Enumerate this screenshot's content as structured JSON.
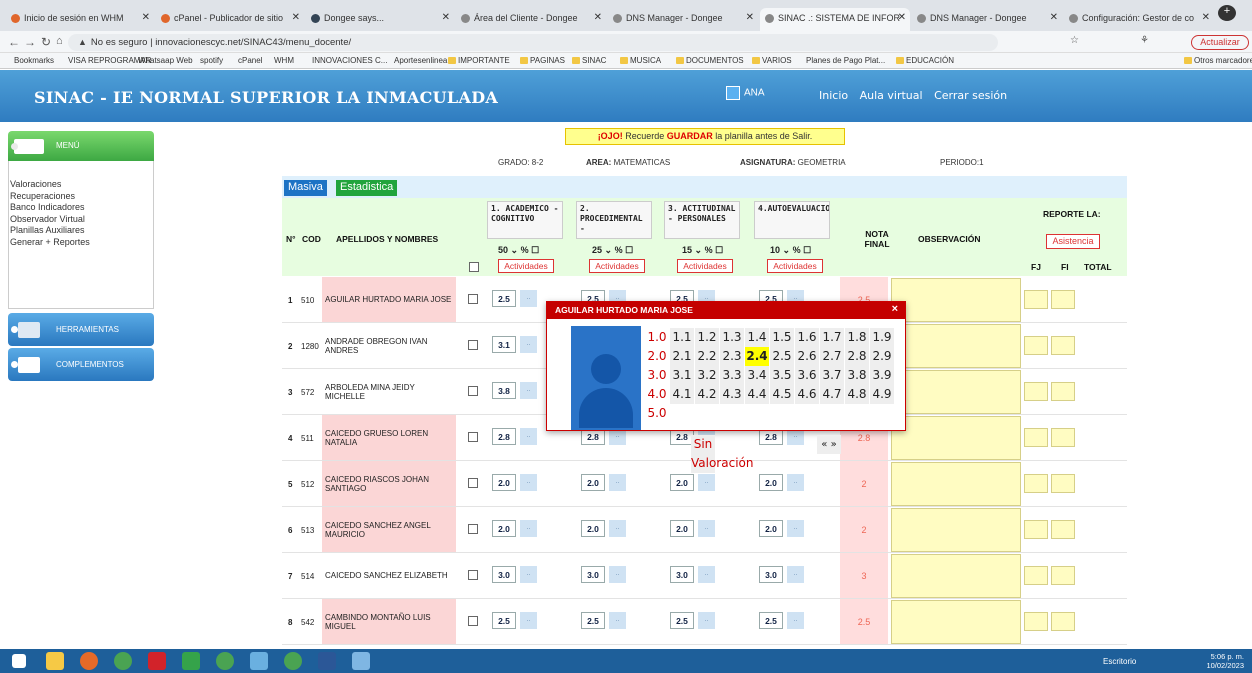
{
  "browser": {
    "tabs": [
      {
        "title": "Inicio de sesión en WHM"
      },
      {
        "title": "cPanel - Publicador de sitio"
      },
      {
        "title": "Dongee says..."
      },
      {
        "title": "Área del Cliente - Dongee"
      },
      {
        "title": "DNS Manager - Dongee"
      },
      {
        "title": "SINAC .: SISTEMA DE INFOR"
      },
      {
        "title": "DNS Manager - Dongee"
      },
      {
        "title": "Configuración: Gestor de co"
      }
    ],
    "security_label": "No es seguro",
    "url": "innovacionescyc.net/SINAC43/menu_docente/",
    "update_button": "Actualizar",
    "bookmarks": [
      "Bookmarks",
      "VISA REPROGRAMAR",
      "Whatsaap Web",
      "spotify",
      "cPanel",
      "WHM",
      "INNOVACIONES C...",
      "Aportesenlinea",
      "IMPORTANTE",
      "PAGINAS",
      "SINAC",
      "MUSICA",
      "DOCUMENTOS",
      "VARIOS",
      "Planes de Pago Plat...",
      "EDUCACIÓN",
      "Otros marcadores"
    ]
  },
  "header": {
    "title": "SINAC - IE NORMAL SUPERIOR LA INMACULADA",
    "user": "ANA",
    "links": [
      "Inicio",
      "Aula virtual",
      "Cerrar sesión"
    ]
  },
  "sidebar": {
    "menu_label": "MENÚ",
    "items": [
      "Valoraciones",
      "Recuperaciones",
      "Banco Indicadores",
      "Observador Virtual",
      "Planillas Auxiliares",
      "Generar + Reportes"
    ],
    "tools_label": "HERRAMIENTAS",
    "complements_label": "COMPLEMENTOS"
  },
  "notice": {
    "prefix": "¡OJO!",
    "middle": " Recuerde ",
    "strong": "GUARDAR",
    "suffix": " la planilla antes de Salir."
  },
  "info": {
    "grado_label": "GRADO:",
    "grado": "8-2",
    "area_label": "AREA:",
    "area": "MATEMATICAS",
    "asignatura_label": "ASIGNATURA:",
    "asignatura": "GEOMETRIA",
    "periodo_label": "PERIODO:",
    "periodo": "1"
  },
  "buttons": {
    "masiva": "Masiva",
    "estadistica": "Estadistica",
    "actividades": "Actividades",
    "asistencia": "Asistencia"
  },
  "table": {
    "col_n": "N°",
    "col_cod": "COD",
    "col_name": "APELLIDOS Y NOMBRES",
    "col_nota": "NOTA FINAL",
    "col_obs": "OBSERVACIÓN",
    "col_reporte": "REPORTE LA:",
    "col_fj": "FJ",
    "col_fi": "FI",
    "col_total": "TOTAL",
    "dimensions": [
      {
        "label": "1. ACADEMICO - COGNITIVO",
        "pct": "50",
        "unit": "%"
      },
      {
        "label": "2. PROCEDIMENTAL -",
        "pct": "25",
        "unit": "%"
      },
      {
        "label": "3. ACTITUDINAL - PERSONALES",
        "pct": "15",
        "unit": "%"
      },
      {
        "label": "4.AUTOEVALUACION",
        "pct": "10",
        "unit": "%"
      }
    ],
    "rows": [
      {
        "n": "1",
        "cod": "510",
        "name": "AGUILAR HURTADO MARIA JOSE",
        "grades": [
          "2.5",
          "2.5",
          "2.5",
          "2.5"
        ],
        "final": "2.5",
        "pink": true
      },
      {
        "n": "2",
        "cod": "1280",
        "name": "ANDRADE OBREGON IVAN ANDRES",
        "grades": [
          "3.1",
          "",
          "",
          ""
        ],
        "final": "",
        "pink": false
      },
      {
        "n": "3",
        "cod": "572",
        "name": "ARBOLEDA MINA JEIDY MICHELLE",
        "grades": [
          "3.8",
          "",
          "",
          ""
        ],
        "final": "",
        "pink": false
      },
      {
        "n": "4",
        "cod": "511",
        "name": "CAICEDO GRUESO LOREN NATALIA",
        "grades": [
          "2.8",
          "2.8",
          "2.8",
          "2.8"
        ],
        "final": "2.8",
        "pink": true
      },
      {
        "n": "5",
        "cod": "512",
        "name": "CAICEDO RIASCOS JOHAN SANTIAGO",
        "grades": [
          "2.0",
          "2.0",
          "2.0",
          "2.0"
        ],
        "final": "2",
        "pink": true
      },
      {
        "n": "6",
        "cod": "513",
        "name": "CAICEDO SANCHEZ ANGEL MAURICIO",
        "grades": [
          "2.0",
          "2.0",
          "2.0",
          "2.0"
        ],
        "final": "2",
        "pink": true
      },
      {
        "n": "7",
        "cod": "514",
        "name": "CAICEDO SANCHEZ ELIZABETH",
        "grades": [
          "3.0",
          "3.0",
          "3.0",
          "3.0"
        ],
        "final": "3",
        "pink": false
      },
      {
        "n": "8",
        "cod": "542",
        "name": "CAMBINDO MONTAÑO LUIS MIGUEL",
        "grades": [
          "2.5",
          "2.5",
          "2.5",
          "2.5"
        ],
        "final": "2.5",
        "pink": true
      }
    ],
    "mini_label": ".."
  },
  "popup": {
    "title": "AGUILAR HURTADO MARIA JOSE",
    "close": "×",
    "grid": [
      [
        "1.0",
        "1.1",
        "1.2",
        "1.3",
        "1.4",
        "1.5",
        "1.6",
        "1.7",
        "1.8",
        "1.9"
      ],
      [
        "2.0",
        "2.1",
        "2.2",
        "2.3",
        "2.4",
        "2.5",
        "2.6",
        "2.7",
        "2.8",
        "2.9"
      ],
      [
        "3.0",
        "3.1",
        "3.2",
        "3.3",
        "3.4",
        "3.5",
        "3.6",
        "3.7",
        "3.8",
        "3.9"
      ],
      [
        "4.0",
        "4.1",
        "4.2",
        "4.3",
        "4.4",
        "4.5",
        "4.6",
        "4.7",
        "4.8",
        "4.9"
      ]
    ],
    "selected": "2.4",
    "last": "5.0",
    "no_value": "Sin Valoración",
    "nav": "« »"
  },
  "taskbar": {
    "desktop_label": "Escritorio",
    "time": "5:06 p. m.",
    "date": "10/02/2023"
  }
}
